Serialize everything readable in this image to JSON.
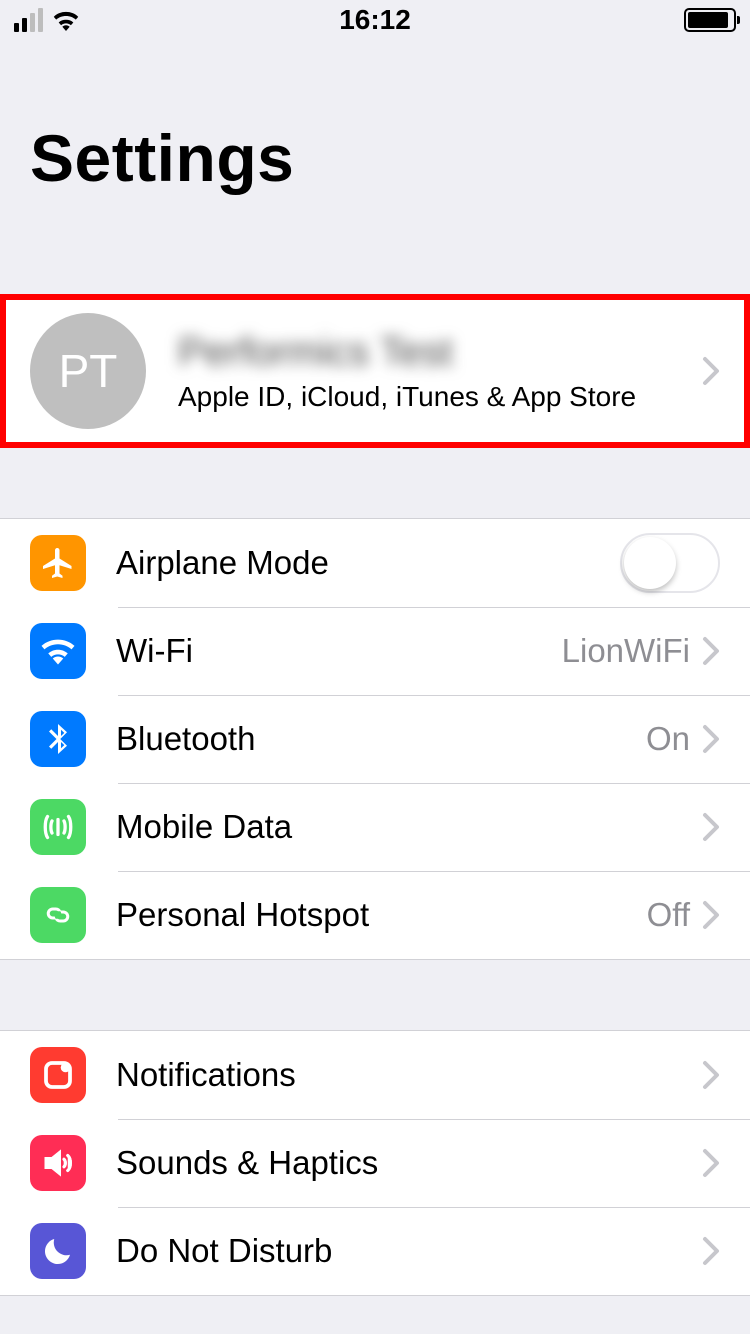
{
  "status": {
    "time": "16:12"
  },
  "title": "Settings",
  "account": {
    "initials": "PT",
    "name": "Performics Test",
    "subtitle": "Apple ID, iCloud, iTunes & App Store"
  },
  "group_connectivity": {
    "airplane": {
      "label": "Airplane Mode",
      "on": false
    },
    "wifi": {
      "label": "Wi-Fi",
      "value": "LionWiFi"
    },
    "bluetooth": {
      "label": "Bluetooth",
      "value": "On"
    },
    "mobile_data": {
      "label": "Mobile Data",
      "value": ""
    },
    "hotspot": {
      "label": "Personal Hotspot",
      "value": "Off"
    }
  },
  "group_notifications": {
    "notifications": {
      "label": "Notifications"
    },
    "sounds": {
      "label": "Sounds & Haptics"
    },
    "dnd": {
      "label": "Do Not Disturb"
    }
  },
  "colors": {
    "highlight": "#ff0000"
  }
}
